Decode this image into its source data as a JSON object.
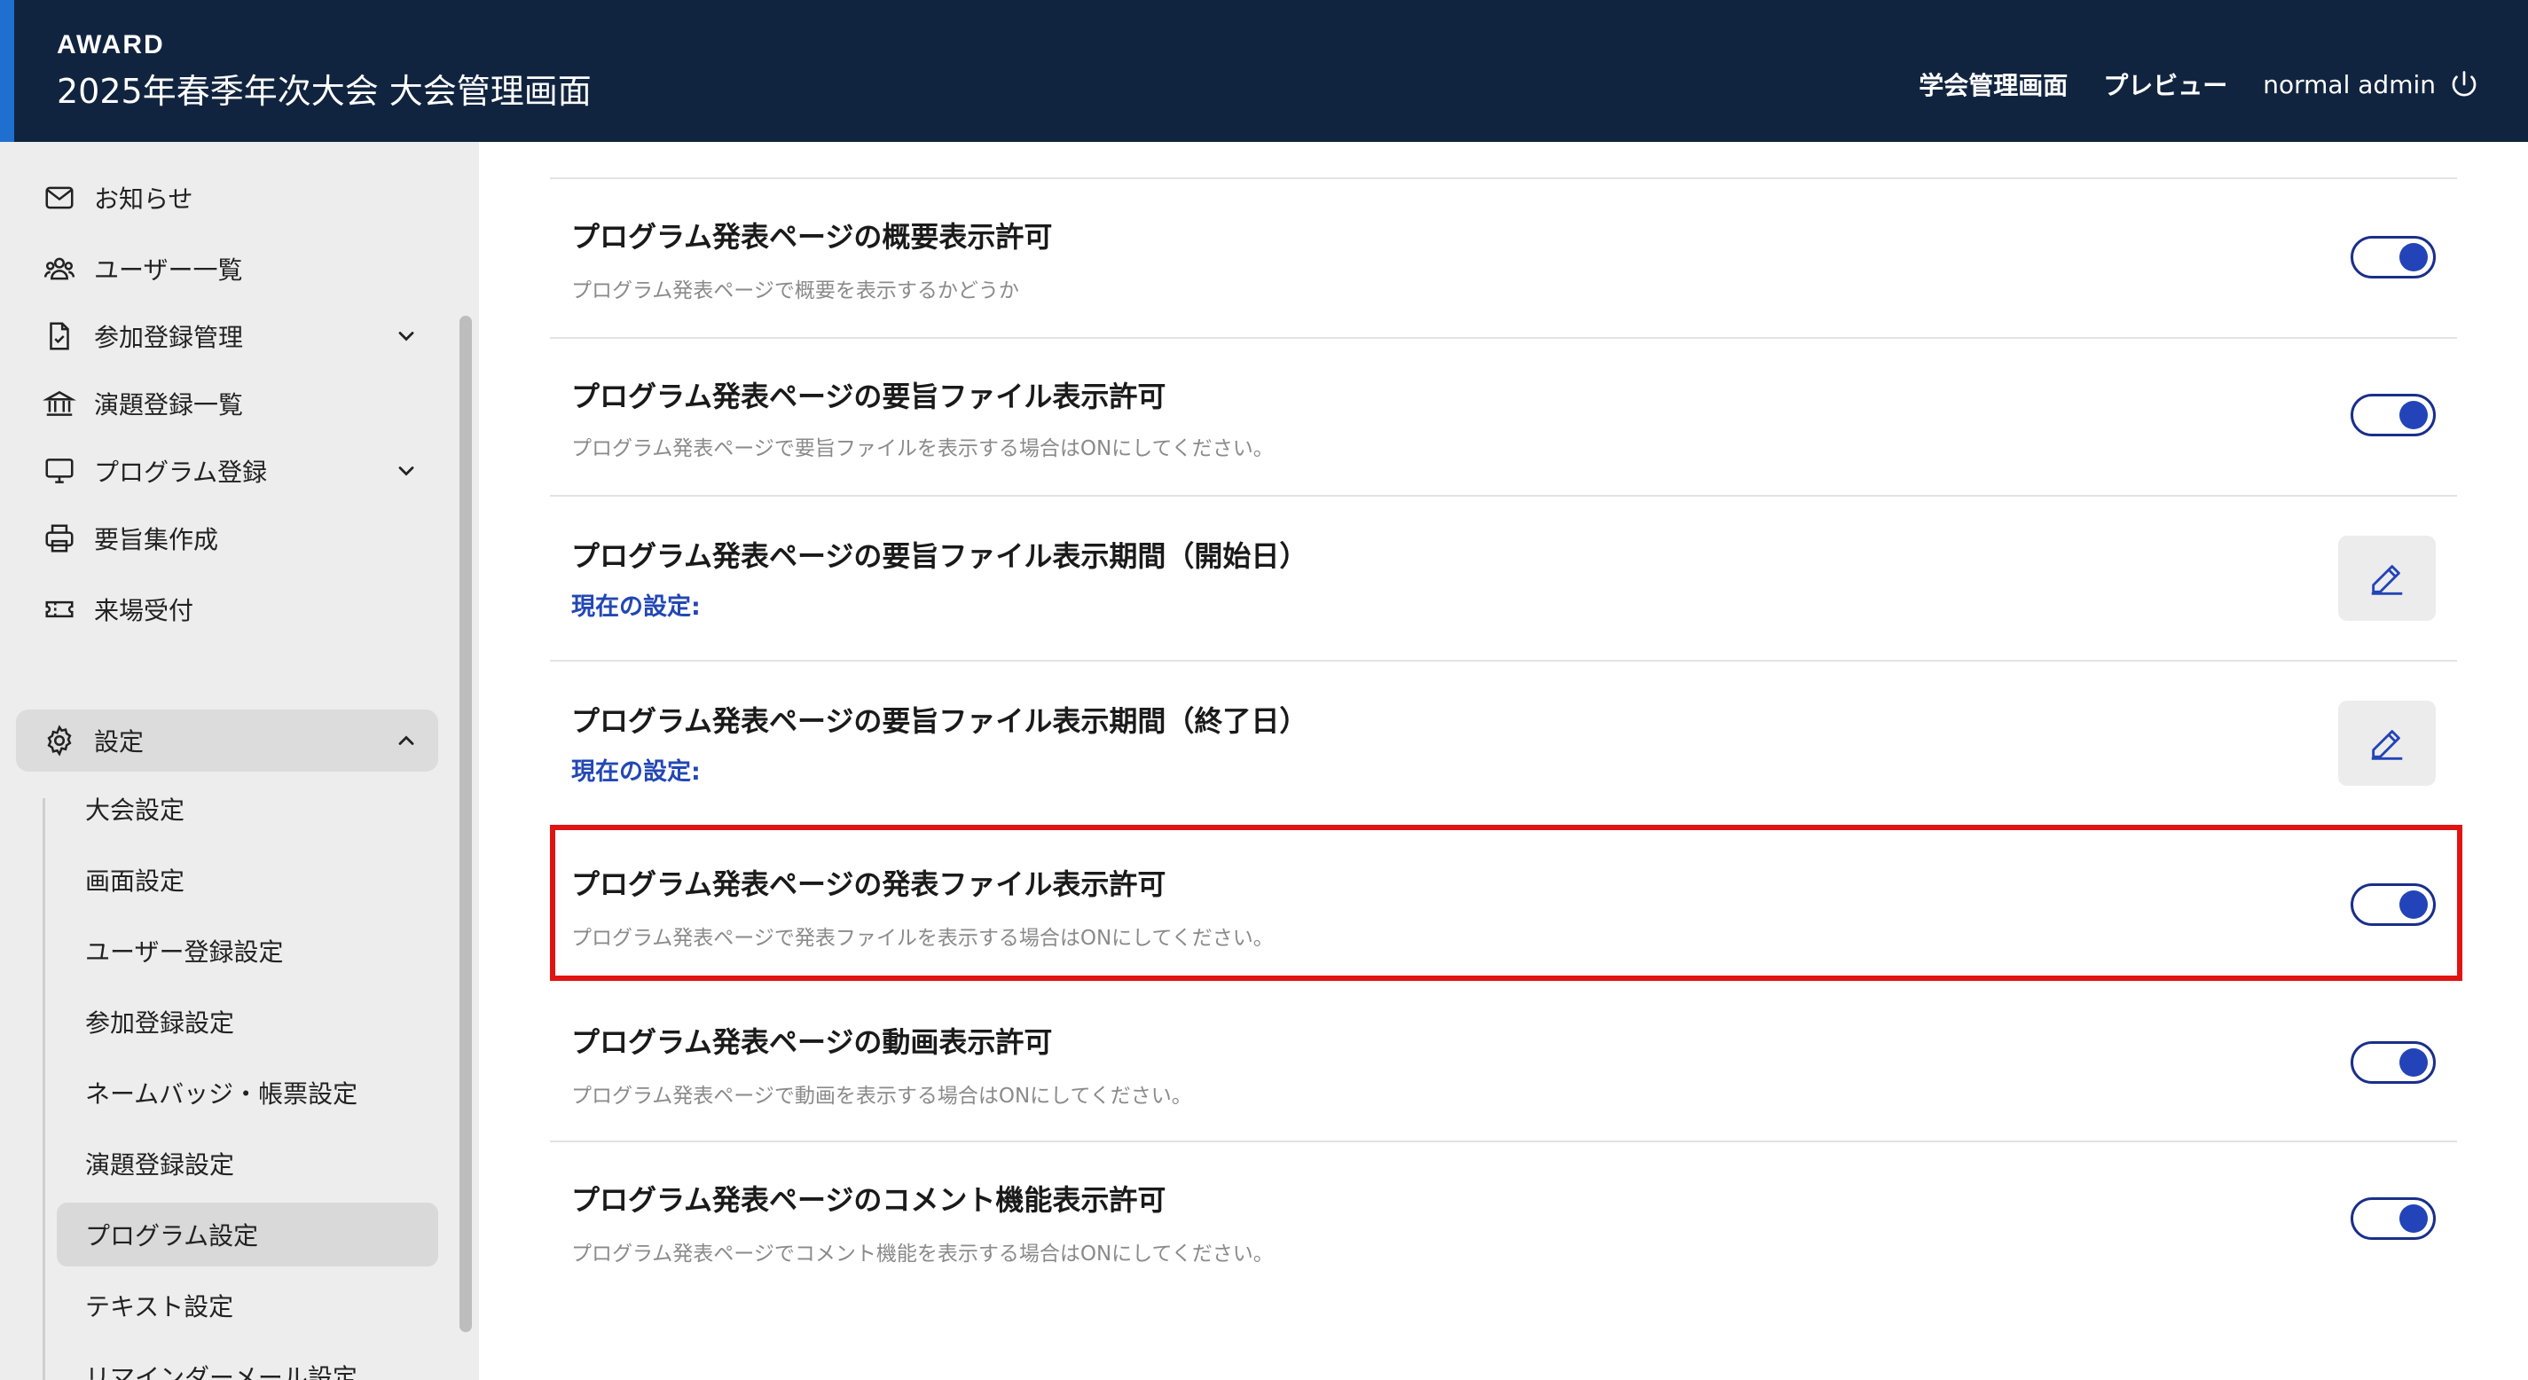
{
  "header": {
    "brand": "AWARD",
    "title": "2025年春季年次大会 大会管理画面",
    "nav": {
      "society_admin": "学会管理画面",
      "preview": "プレビュー",
      "user": "normal admin"
    }
  },
  "sidebar": {
    "items": [
      {
        "label": "お知らせ",
        "icon": "mail-icon"
      },
      {
        "label": "ユーザー一覧",
        "icon": "users-icon"
      },
      {
        "label": "参加登録管理",
        "icon": "document-check-icon"
      },
      {
        "label": "演題登録一覧",
        "icon": "building-icon"
      },
      {
        "label": "プログラム登録",
        "icon": "monitor-icon"
      },
      {
        "label": "要旨集作成",
        "icon": "printer-icon"
      },
      {
        "label": "来場受付",
        "icon": "ticket-icon"
      }
    ],
    "settings": {
      "label": "設定",
      "sub_items": [
        "大会設定",
        "画面設定",
        "ユーザー登録設定",
        "参加登録設定",
        "ネームバッジ・帳票設定",
        "演題登録設定",
        "プログラム設定",
        "テキスト設定",
        "リマインダーメール設定"
      ],
      "active": "プログラム設定"
    }
  },
  "settings_rows": [
    {
      "title": "プログラム発表ページの概要表示許可",
      "desc": "プログラム発表ページで概要を表示するかどうか",
      "toggle_on": true
    },
    {
      "title": "プログラム発表ページの要旨ファイル表示許可",
      "desc": "プログラム発表ページで要旨ファイルを表示する場合はONにしてください。",
      "toggle_on": true
    },
    {
      "title": "プログラム発表ページの要旨ファイル表示期間（開始日）",
      "current": "現在の設定:"
    },
    {
      "title": "プログラム発表ページの要旨ファイル表示期間（終了日）",
      "current": "現在の設定:"
    },
    {
      "title": "プログラム発表ページの発表ファイル表示許可",
      "desc": "プログラム発表ページで発表ファイルを表示する場合はONにしてください。",
      "toggle_on": true
    },
    {
      "title": "プログラム発表ページの動画表示許可",
      "desc": "プログラム発表ページで動画を表示する場合はONにしてください。",
      "toggle_on": true
    },
    {
      "title": "プログラム発表ページのコメント機能表示許可",
      "desc": "プログラム発表ページでコメント機能を表示する場合はONにしてください。",
      "toggle_on": true
    }
  ],
  "colors": {
    "header_bg": "#11243f",
    "accent": "#1f6fd1",
    "toggle": "#2344b8",
    "highlight": "#e11414",
    "current_label": "#2347b5"
  }
}
